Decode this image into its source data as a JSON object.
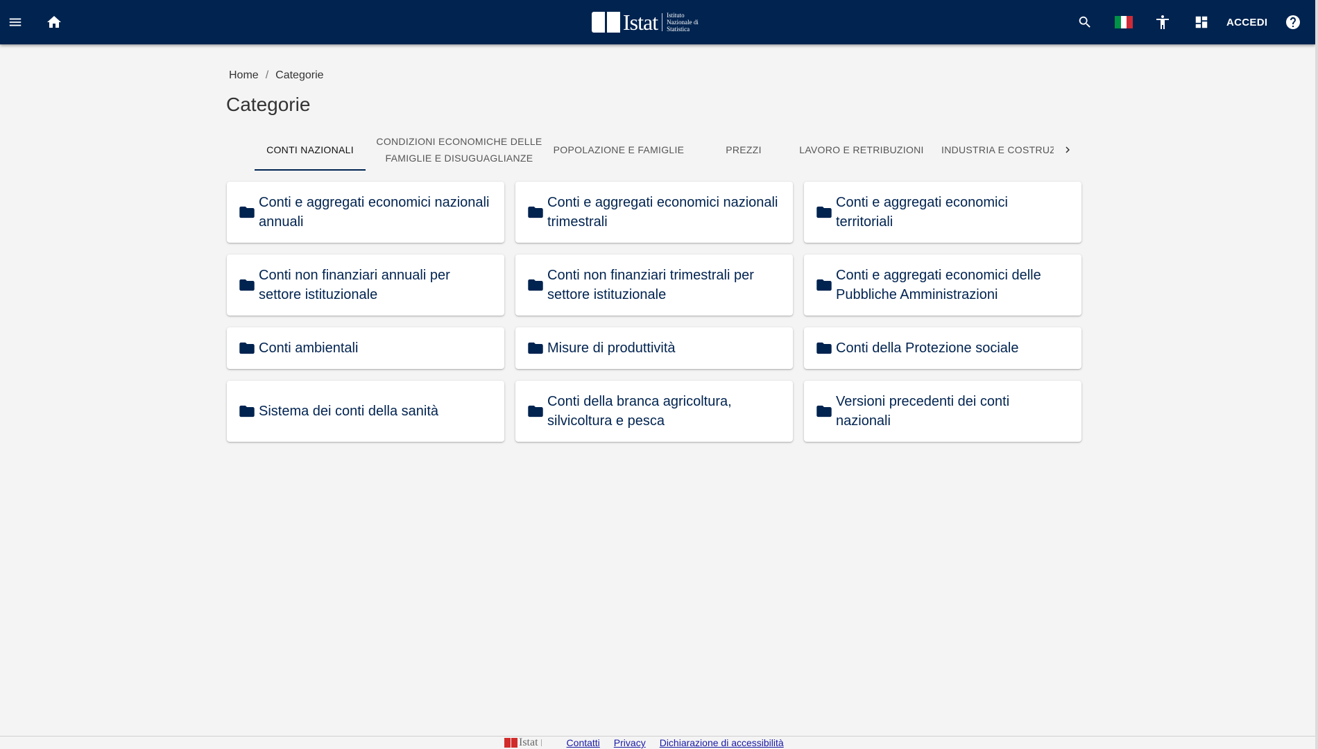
{
  "header": {
    "logo_text": "Istat",
    "logo_subtitle": "Istituto Nazionale di Statistica",
    "login_label": "ACCEDI",
    "background_color": "#002350",
    "flag_colors": [
      "#009246",
      "#ffffff",
      "#ce2b37"
    ]
  },
  "breadcrumb": {
    "home": "Home",
    "separator": "/",
    "current": "Categorie"
  },
  "page": {
    "title": "Categorie"
  },
  "tabs": [
    {
      "label": "CONTI NAZIONALI",
      "active": true
    },
    {
      "label": "CONDIZIONI ECONOMICHE DELLE FAMIGLIE E DISUGUAGLIANZE",
      "active": false
    },
    {
      "label": "POPOLAZIONE E FAMIGLIE",
      "active": false
    },
    {
      "label": "PREZZI",
      "active": false
    },
    {
      "label": "LAVORO E RETRIBUZIONI",
      "active": false
    },
    {
      "label": "INDUSTRIA E COSTRUZI",
      "active": false
    }
  ],
  "cards": [
    {
      "label": "Conti e aggregati economici nazionali annuali",
      "icon": "folder-icon"
    },
    {
      "label": "Conti e aggregati economici nazionali trimestrali",
      "icon": "folder-icon"
    },
    {
      "label": "Conti e aggregati economici territoriali",
      "icon": "folder-icon"
    },
    {
      "label": "Conti non finanziari annuali per settore istituzionale",
      "icon": "folder-icon"
    },
    {
      "label": "Conti non finanziari trimestrali per settore istituzionale",
      "icon": "folder-icon"
    },
    {
      "label": "Conti e aggregati economici delle Pubbliche Amministrazioni",
      "icon": "folder-icon"
    },
    {
      "label": "Conti ambientali",
      "icon": "folder-icon"
    },
    {
      "label": "Misure di produttività",
      "icon": "folder-icon"
    },
    {
      "label": "Conti della Protezione sociale",
      "icon": "folder-icon"
    },
    {
      "label": "Sistema dei conti della sanità",
      "icon": "folder-icon"
    },
    {
      "label": "Conti della branca agricoltura, silvicoltura e pesca",
      "icon": "folder-icon"
    },
    {
      "label": "Versioni precedenti dei conti nazionali",
      "icon": "folder-icon"
    }
  ],
  "footer": {
    "logo_text": "Istat",
    "links": [
      "Contatti",
      "Privacy",
      "Dichiarazione di accessibilità"
    ]
  }
}
